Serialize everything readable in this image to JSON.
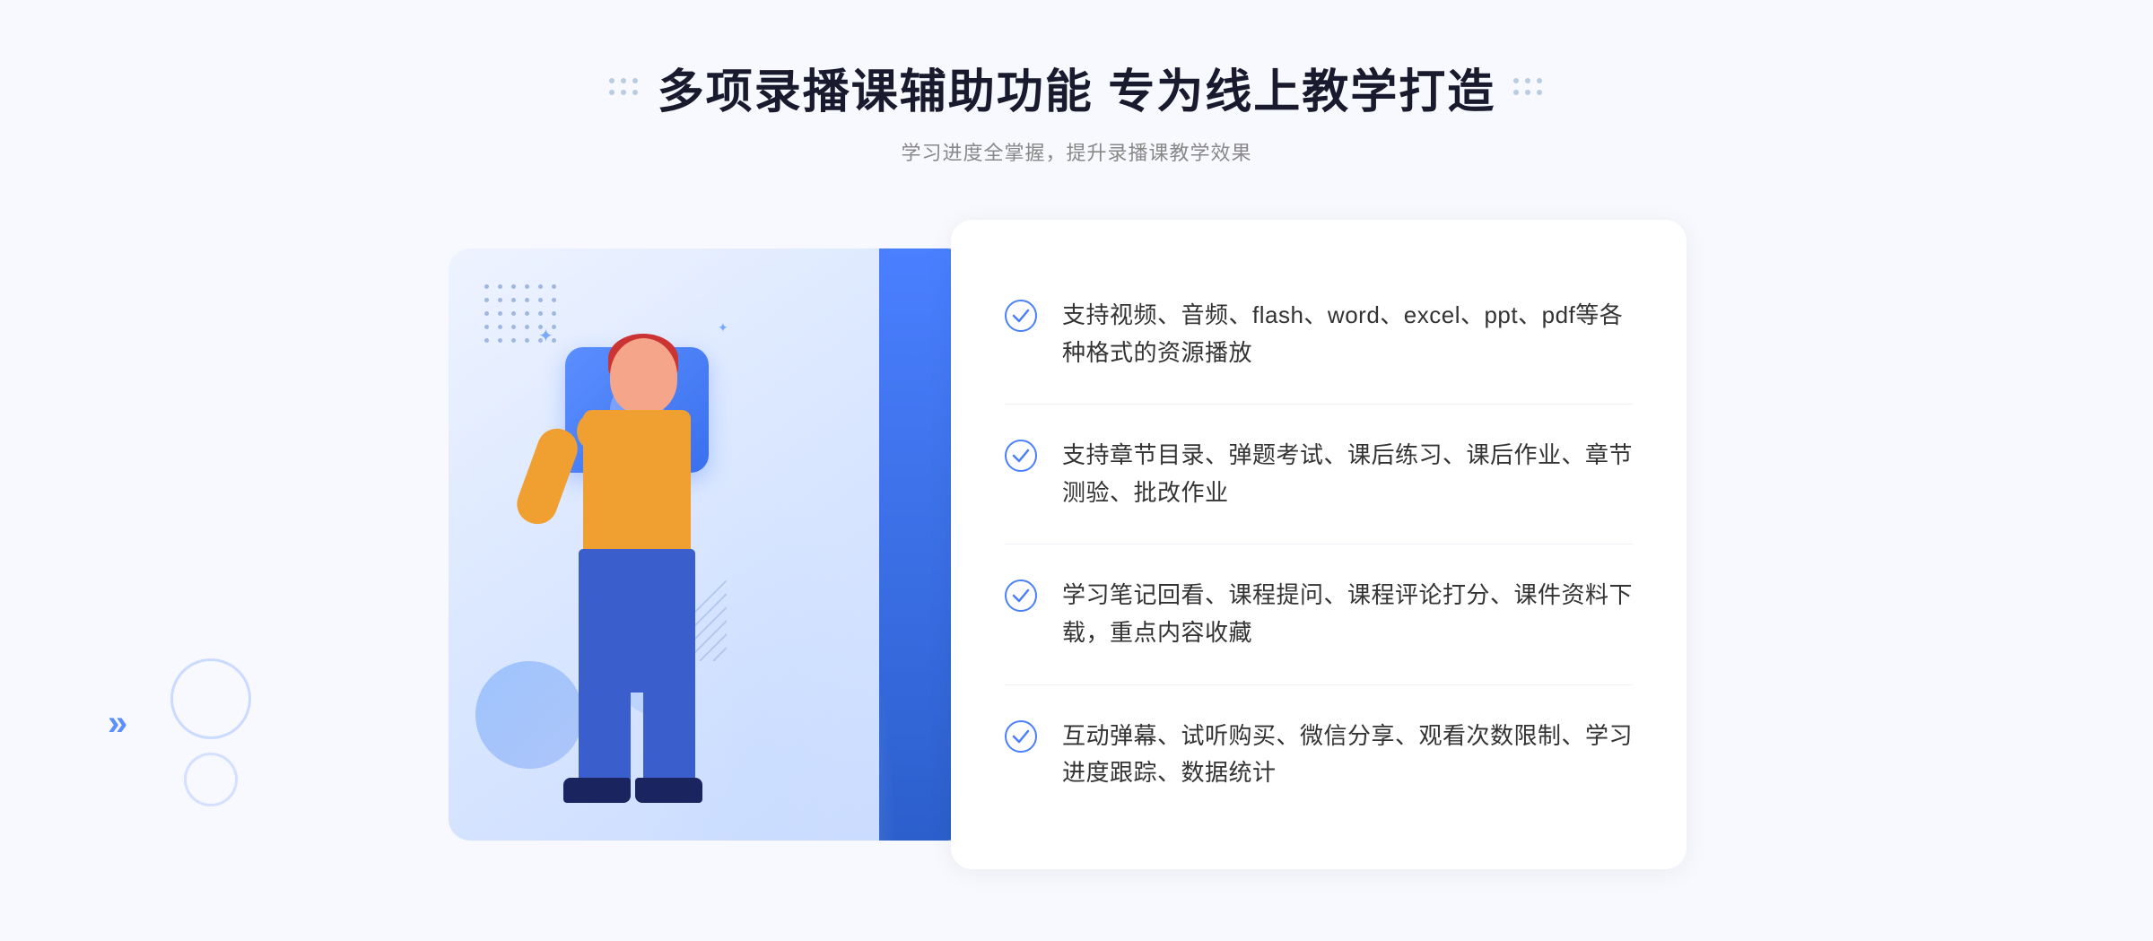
{
  "page": {
    "background": "#f8f9ff"
  },
  "header": {
    "title": "多项录播课辅助功能 专为线上教学打造",
    "subtitle": "学习进度全掌握，提升录播课教学效果",
    "dots_left": "decorative-dots-left",
    "dots_right": "decorative-dots-right"
  },
  "features": [
    {
      "id": 1,
      "text": "支持视频、音频、flash、word、excel、ppt、pdf等各种格式的资源播放",
      "icon": "check-circle-icon"
    },
    {
      "id": 2,
      "text": "支持章节目录、弹题考试、课后练习、课后作业、章节测验、批改作业",
      "icon": "check-circle-icon"
    },
    {
      "id": 3,
      "text": "学习笔记回看、课程提问、课程评论打分、课件资料下载，重点内容收藏",
      "icon": "check-circle-icon"
    },
    {
      "id": 4,
      "text": "互动弹幕、试听购买、微信分享、观看次数限制、学习进度跟踪、数据统计",
      "icon": "check-circle-icon"
    }
  ],
  "illustration": {
    "play_button": "play-icon",
    "person": "person-pointing-illustration"
  }
}
